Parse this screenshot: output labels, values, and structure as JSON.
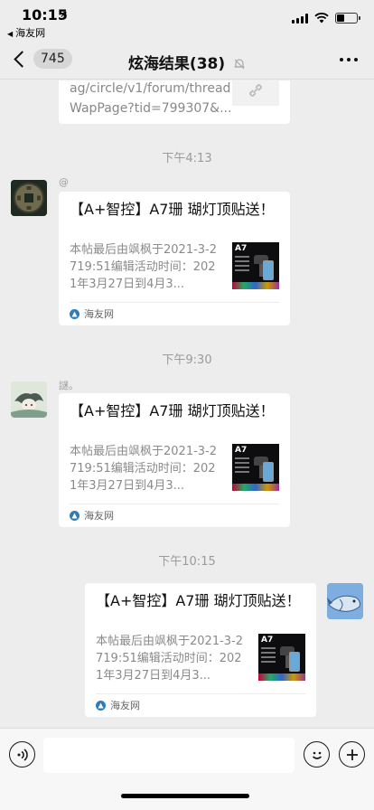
{
  "status": {
    "time": "10:15",
    "back_app": "海友网",
    "icons": [
      "location-arrow-icon",
      "signal-icon",
      "wifi-icon",
      "battery-icon"
    ]
  },
  "nav": {
    "unread_count": "745",
    "title": "炫海结果(38)",
    "icons": [
      "back-chevron-icon",
      "mute-bell-icon",
      "more-dots-icon"
    ]
  },
  "partial_card": {
    "url_line1": "ag/circle/v1/forum/thread",
    "url_line2": "WapPage?tid=799307&..."
  },
  "messages": [
    {
      "timestamp": "下午4:13",
      "sender": "@",
      "title": "【A+智控】A7珊 瑚灯顶贴送！",
      "desc": "本帖最后由飒枫于2021-3-2719:51编辑活动时间：2021年3月27日到4月3...",
      "thumb_label": "A7",
      "source": "海友网"
    },
    {
      "timestamp": "下午9:30",
      "sender": "謎。",
      "title": "【A+智控】A7珊 瑚灯顶贴送！",
      "desc": "本帖最后由飒枫于2021-3-2719:51编辑活动时间：2021年3月27日到4月3...",
      "thumb_label": "A7",
      "source": "海友网"
    },
    {
      "timestamp": "下午10:15",
      "sender": "",
      "title": "【A+智控】A7珊 瑚灯顶贴送！",
      "desc": "本帖最后由飒枫于2021-3-2719:51编辑活动时间：2021年3月27日到4月3...",
      "thumb_label": "A7",
      "source": "海友网"
    }
  ],
  "input_bar": {
    "value": "",
    "icons": [
      "voice-icon",
      "emoji-icon",
      "plus-icon"
    ]
  },
  "colors": {
    "background": "#ededed",
    "card": "#ffffff",
    "timestamp": "#9b9b9b",
    "source_logo": "#2e7db8"
  }
}
